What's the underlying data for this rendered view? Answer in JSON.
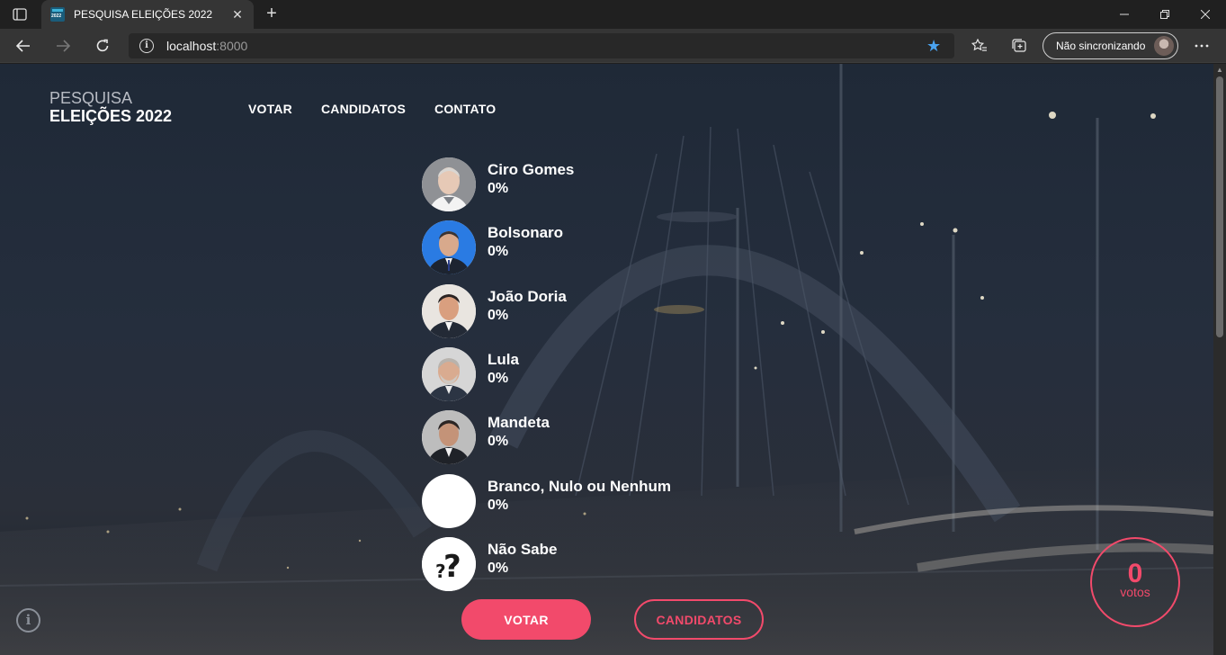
{
  "browser": {
    "tab_title": "PESQUISA ELEIÇÕES 2022",
    "tab_close": "✕",
    "new_tab": "+",
    "url_host": "localhost",
    "url_port": ":8000",
    "profile_label": "Não sincronizando"
  },
  "site": {
    "brand_line1": "PESQUISA",
    "brand_line2": "ELEIÇÕES 2022",
    "nav": [
      "VOTAR",
      "CANDIDATOS",
      "CONTATO"
    ]
  },
  "candidates": [
    {
      "name": "Ciro Gomes",
      "percent": "0%",
      "photo": "ciro-gomes-photo"
    },
    {
      "name": "Bolsonaro",
      "percent": "0%",
      "photo": "bolsonaro-photo"
    },
    {
      "name": "João Doria",
      "percent": "0%",
      "photo": "joao-doria-photo"
    },
    {
      "name": "Lula",
      "percent": "0%",
      "photo": "lula-photo"
    },
    {
      "name": "Mandeta",
      "percent": "0%",
      "photo": "mandeta-photo"
    },
    {
      "name": "Branco, Nulo ou Nenhum",
      "percent": "0%",
      "photo": "blank-circle"
    },
    {
      "name": "Não Sabe",
      "percent": "0%",
      "photo": "question-marks-icon"
    }
  ],
  "actions": {
    "vote_label": "VOTAR",
    "candidates_label": "CANDIDATOS"
  },
  "vote_counter": {
    "count": "0",
    "label": "votos"
  },
  "colors": {
    "accent": "#f24a6b",
    "background": "#1f2937"
  }
}
